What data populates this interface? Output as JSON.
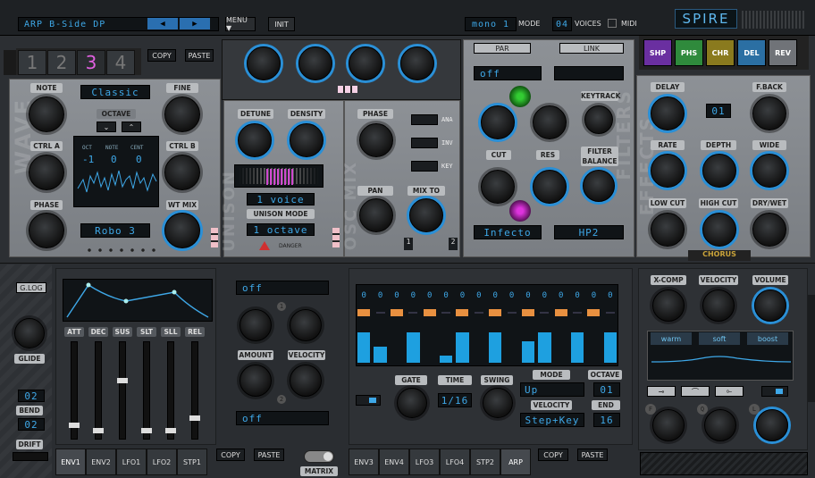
{
  "topbar": {
    "preset": "ARP B-Side DP",
    "menu": "MENU ▼",
    "init": "INIT",
    "mode_value": "mono  1",
    "mode_label": "MODE",
    "voices_value": "04",
    "voices_label": "VOICES",
    "midi": "MIDI",
    "logo": "SPIRE"
  },
  "osc": {
    "tabs": [
      "1",
      "2",
      "3",
      "4"
    ],
    "active_tab": "3",
    "copy": "COPY",
    "paste": "PASTE",
    "wave_label": "WAVE",
    "note": "NOTE",
    "fine": "FINE",
    "wave_name": "Classic",
    "octave": "OCTAVE",
    "oct_lbl": "OCT",
    "note_lbl": "NOTE",
    "cent_lbl": "CENT",
    "oct_val": "-1",
    "note_val": "0",
    "cent_val": "0",
    "ctrl_a": "CTRL A",
    "ctrl_b": "CTRL B",
    "phase": "PHASE",
    "wt_mix": "WT MIX",
    "wavetable": "Robo 3"
  },
  "unison": {
    "label": "UNISON",
    "detune": "DETUNE",
    "density": "DENSITY",
    "voice": "1 voice",
    "mode_lbl": "UNISON MODE",
    "octave": "1 octave",
    "danger": "DANGER"
  },
  "oscmix": {
    "label": "OSC MIX",
    "phase": "PHASE",
    "pan": "PAN",
    "mix_to": "MIX TO",
    "ana": "ANA",
    "inv": "INV",
    "key": "KEY",
    "ch1": "1",
    "ch2": "2"
  },
  "filter": {
    "label": "FILTERS",
    "par": "PAR",
    "link": "LINK",
    "type1": "off",
    "keytrack": "KEYTRACK",
    "cut": "CUT",
    "res": "RES",
    "balance": "FILTER BALANCE",
    "f1": "Infecto",
    "f2": "HP2"
  },
  "effects": {
    "label": "EFFECTS",
    "tabs": [
      {
        "t": "SHP",
        "c": "#6a2fa0"
      },
      {
        "t": "PHS",
        "c": "#2f8a3c"
      },
      {
        "t": "CHR",
        "c": "#8a7a1e"
      },
      {
        "t": "DEL",
        "c": "#2b6fa3"
      },
      {
        "t": "REV",
        "c": "#707378"
      }
    ],
    "delay": "DELAY",
    "fback": "F.BACK",
    "fb_val": "01",
    "rate": "RATE",
    "depth": "DEPTH",
    "wide": "WIDE",
    "low_cut": "LOW CUT",
    "high_cut": "HIGH CUT",
    "dry_wet": "DRY/WET",
    "chorus": "CHORUS"
  },
  "left": {
    "glog": "G.LOG",
    "glide": "GLIDE",
    "bend": "BEND",
    "bend1": "02",
    "bend2": "02",
    "drift": "DRIFT"
  },
  "env": {
    "labels": [
      "ATT",
      "DEC",
      "SUS",
      "SLT",
      "SLL",
      "REL"
    ],
    "tabs": [
      "ENV1",
      "ENV2",
      "LFO1",
      "LFO2",
      "STP1"
    ],
    "copy": "COPY",
    "paste": "PASTE"
  },
  "mod": {
    "src1": "off",
    "src2": "off",
    "amount": "AMOUNT",
    "velocity": "VELOCITY",
    "n1": "1",
    "n2": "2",
    "matrix": "MATRIX"
  },
  "arp": {
    "values": [
      "0",
      "0",
      "0",
      "0",
      "0",
      "0",
      "0",
      "0",
      "0",
      "0",
      "0",
      "0",
      "0",
      "0",
      "0",
      "0"
    ],
    "bars": [
      0.85,
      0.45,
      0,
      0.85,
      0,
      0.2,
      0.85,
      0,
      0.85,
      0,
      0.6,
      0.85,
      0,
      0.85,
      0,
      0.85
    ],
    "gate": "GATE",
    "time": "TIME",
    "time_val": "1/16",
    "swing": "SWING",
    "mode": "MODE",
    "mode_val": "Up",
    "octave": "OCTAVE",
    "oct_val": "01",
    "velocity": "VELOCITY",
    "vel_val": "Step+Key",
    "end": "END",
    "end_val": "16",
    "tabs": [
      "ENV3",
      "ENV4",
      "LFO3",
      "LFO4",
      "STP2",
      "ARP"
    ],
    "copy": "COPY",
    "paste": "PASTE"
  },
  "eq": {
    "xcomp": "X-COMP",
    "velocity": "VELOCITY",
    "volume": "VOLUME",
    "warm": "warm",
    "soft": "soft",
    "boost": "boost",
    "f": "F",
    "q": "Q",
    "l": "L"
  }
}
